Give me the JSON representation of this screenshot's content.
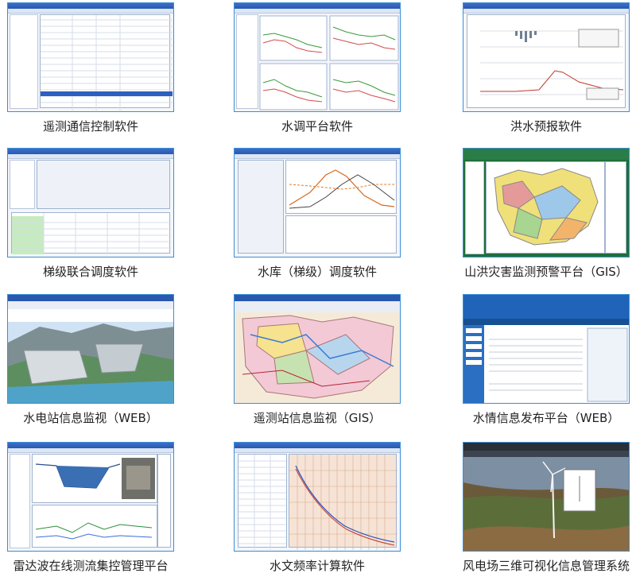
{
  "tiles": [
    {
      "caption": "遥测通信控制软件"
    },
    {
      "caption": "水调平台软件"
    },
    {
      "caption": "洪水预报软件"
    },
    {
      "caption": "梯级联合调度软件"
    },
    {
      "caption": "水库（梯级）调度软件"
    },
    {
      "caption": "山洪灾害监测预警平台（GIS）"
    },
    {
      "caption": "水电站信息监视（WEB）"
    },
    {
      "caption": "遥测站信息监视（GIS）"
    },
    {
      "caption": "水情信息发布平台（WEB）"
    },
    {
      "caption": "雷达波在线测流集控管理平台"
    },
    {
      "caption": "水文频率计算软件"
    },
    {
      "caption": "风电场三维可视化信息管理系统"
    }
  ],
  "colors": {
    "frame_border": "#3a8fd6",
    "window_title": "#2a58b0"
  }
}
